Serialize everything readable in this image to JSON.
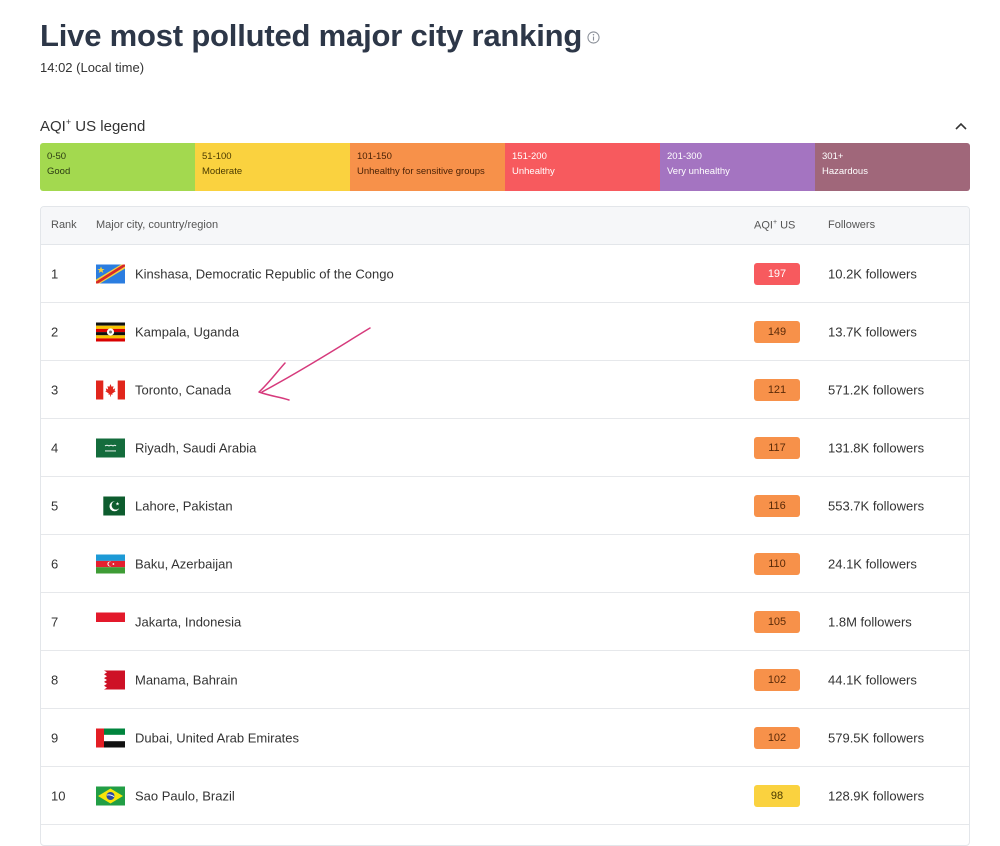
{
  "page": {
    "title": "Live most polluted major city ranking",
    "local_time": "14:02 (Local time)"
  },
  "legend": {
    "title_main": "AQI",
    "title_sup": "+",
    "title_tail": " US legend",
    "segments": [
      {
        "range": "0-50",
        "label": "Good",
        "color": "#a3d94f",
        "text_color": "#2b3b12"
      },
      {
        "range": "51-100",
        "label": "Moderate",
        "color": "#fad23f",
        "text_color": "#4a3a00"
      },
      {
        "range": "101-150",
        "label": "Unhealthy for sensitive groups",
        "color": "#f7914a",
        "text_color": "#4a2206"
      },
      {
        "range": "151-200",
        "label": "Unhealthy",
        "color": "#f75a5e",
        "text_color": "#ffffff"
      },
      {
        "range": "201-300",
        "label": "Very unhealthy",
        "color": "#a474c1",
        "text_color": "#ffffff"
      },
      {
        "range": "301+",
        "label": "Hazardous",
        "color": "#a0677a",
        "text_color": "#ffffff"
      }
    ]
  },
  "table": {
    "headers": {
      "rank": "Rank",
      "city": "Major city, country/region",
      "aqi_main": "AQI",
      "aqi_sup": "+",
      "aqi_tail": " US",
      "followers": "Followers"
    },
    "rows": [
      {
        "rank": "1",
        "city": "Kinshasa, Democratic Republic of the Congo",
        "aqi": "197",
        "followers": "10.2K followers",
        "flag": "drc-flag"
      },
      {
        "rank": "2",
        "city": "Kampala, Uganda",
        "aqi": "149",
        "followers": "13.7K followers",
        "flag": "uganda-flag"
      },
      {
        "rank": "3",
        "city": "Toronto, Canada",
        "aqi": "121",
        "followers": "571.2K followers",
        "flag": "canada-flag"
      },
      {
        "rank": "4",
        "city": "Riyadh, Saudi Arabia",
        "aqi": "117",
        "followers": "131.8K followers",
        "flag": "saudi-flag"
      },
      {
        "rank": "5",
        "city": "Lahore, Pakistan",
        "aqi": "116",
        "followers": "553.7K followers",
        "flag": "pakistan-flag"
      },
      {
        "rank": "6",
        "city": "Baku, Azerbaijan",
        "aqi": "110",
        "followers": "24.1K followers",
        "flag": "azerbaijan-flag"
      },
      {
        "rank": "7",
        "city": "Jakarta, Indonesia",
        "aqi": "105",
        "followers": "1.8M followers",
        "flag": "indonesia-flag"
      },
      {
        "rank": "8",
        "city": "Manama, Bahrain",
        "aqi": "102",
        "followers": "44.1K followers",
        "flag": "bahrain-flag"
      },
      {
        "rank": "9",
        "city": "Dubai, United Arab Emirates",
        "aqi": "102",
        "followers": "579.5K followers",
        "flag": "uae-flag"
      },
      {
        "rank": "10",
        "city": "Sao Paulo, Brazil",
        "aqi": "98",
        "followers": "128.9K followers",
        "flag": "brazil-flag"
      }
    ]
  },
  "icons": {
    "info": "info-icon",
    "collapse": "chevron-up-icon",
    "annotation": "hand-drawn-arrow"
  },
  "colors": {
    "aqi_unhealthy": "#f75a5e",
    "aqi_sensitive": "#f7914a",
    "aqi_moderate": "#fad23f",
    "annotation": "#d63a7c"
  }
}
